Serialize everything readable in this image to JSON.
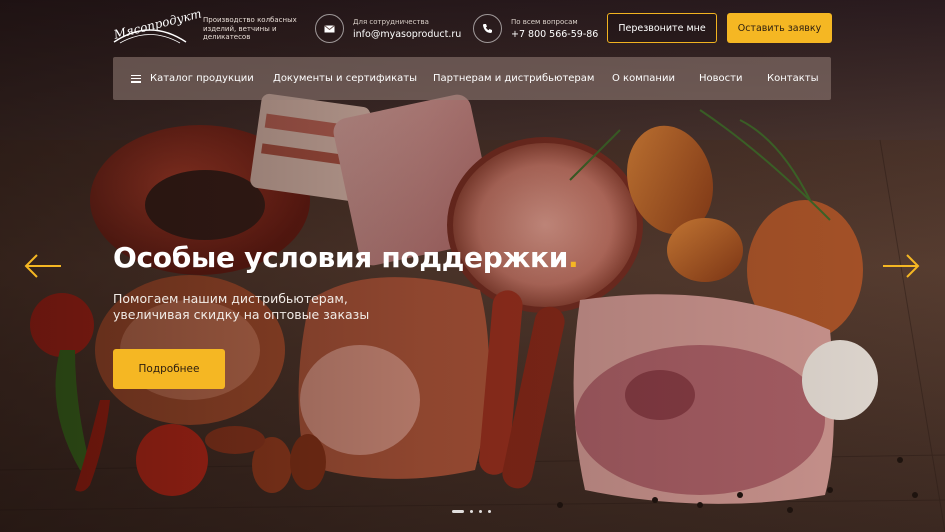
{
  "header": {
    "logo_text": "Мясопродукт",
    "tagline": "Производство колбасных изделий, ветчины и деликатесов",
    "email_caption": "Для сотрудничества",
    "email": "info@myasoproduct.ru",
    "phone_caption": "По всем вопросам",
    "phone": "+7 800 566-59-86",
    "call_button": "Перезвоните мне",
    "request_button": "Оставить заявку"
  },
  "nav": {
    "items": [
      {
        "label": "Каталог продукции"
      },
      {
        "label": "Документы и сертификаты"
      },
      {
        "label": "Партнерам и дистрибьютерам"
      },
      {
        "label": "О компании"
      },
      {
        "label": "Новости"
      },
      {
        "label": "Контакты"
      }
    ]
  },
  "hero": {
    "title": "Особые условия поддержки",
    "title_dot": ".",
    "subtitle": "Помогаем нашим дистрибьютерам, увеличивая скидку на оптовые заказы",
    "button": "Подробнее"
  },
  "slider": {
    "slides": 3,
    "active": 1
  },
  "colors": {
    "accent": "#f5b723",
    "nav_bg": "#968078"
  },
  "icons": {
    "email": "mail-icon",
    "phone": "phone-icon",
    "menu": "burger-menu-icon",
    "prev": "arrow-left-icon",
    "next": "arrow-right-icon"
  }
}
